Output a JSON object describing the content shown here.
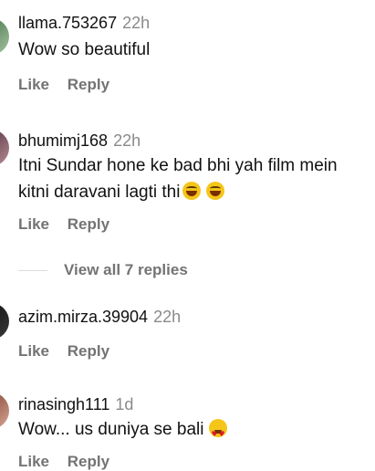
{
  "comments": [
    {
      "username": "llama.753267",
      "time": "22h",
      "text": "Wow so beautiful",
      "like_label": "Like",
      "reply_label": "Reply"
    },
    {
      "username": "bhumimj168",
      "time": "22h",
      "text": "Itni Sundar hone ke bad bhi yah film mein kitni daravani lagti thi",
      "like_label": "Like",
      "reply_label": "Reply",
      "emojis": [
        "laughing-emoji",
        "laughing-emoji"
      ]
    },
    {
      "username": "azim.mirza.39904",
      "time": "22h",
      "text": "",
      "like_label": "Like",
      "reply_label": "Reply"
    },
    {
      "username": "rinasingh111",
      "time": "1d",
      "text": "Wow... us duniya se bali",
      "emojis": [
        "heart-eyes-emoji"
      ],
      "like_label": "Like",
      "reply_label": "Reply"
    }
  ],
  "view_replies_label": "View all 7 replies",
  "colors": {
    "text": "#111111",
    "secondary": "#737373",
    "timestamp": "#8a8a8a"
  }
}
